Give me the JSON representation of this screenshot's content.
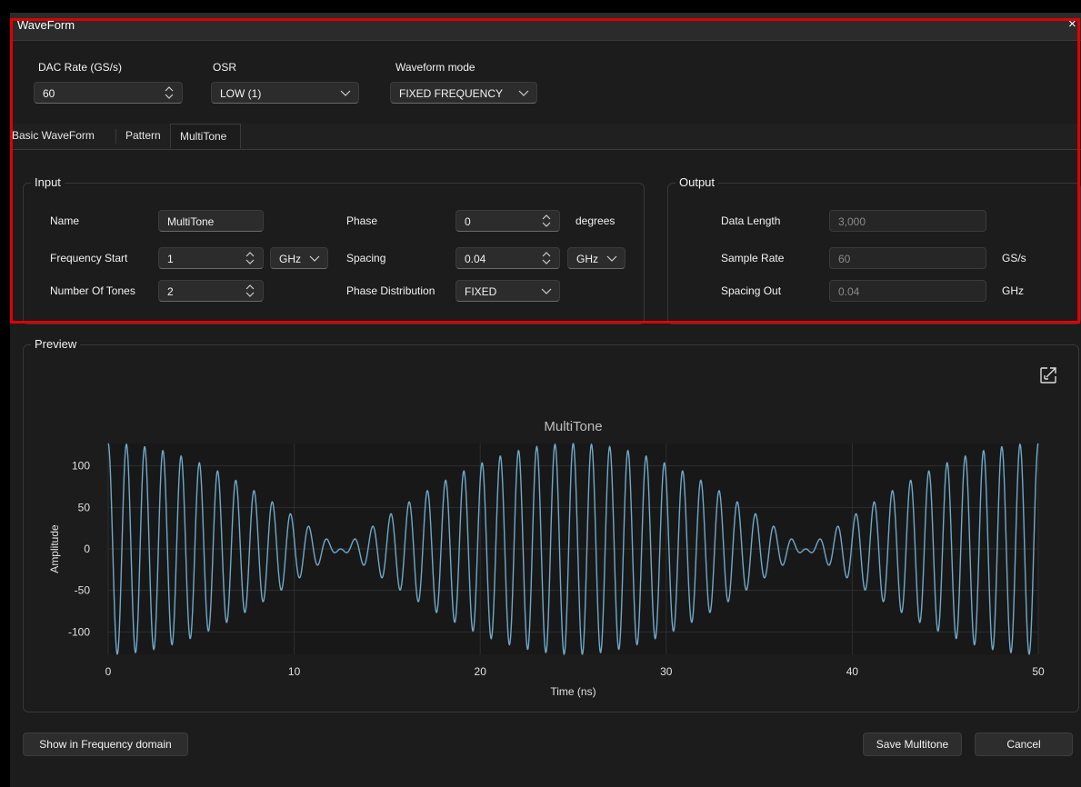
{
  "window": {
    "title": "WaveForm",
    "close": "×"
  },
  "top": {
    "dac_rate_label": "DAC Rate (GS/s)",
    "dac_rate_value": "60",
    "osr_label": "OSR",
    "osr_value": "LOW (1)",
    "waveform_mode_label": "Waveform mode",
    "waveform_mode_value": "FIXED FREQUENCY"
  },
  "tabs": [
    {
      "label": "Basic WaveForm"
    },
    {
      "label": "Pattern"
    },
    {
      "label": "MultiTone",
      "active": true
    }
  ],
  "input": {
    "title": "Input",
    "name_label": "Name",
    "name_value": "MultiTone",
    "freq_start_label": "Frequency Start",
    "freq_start_value": "1",
    "freq_unit": "GHz",
    "num_tones_label": "Number Of Tones",
    "num_tones_value": "2",
    "phase_label": "Phase",
    "phase_value": "0",
    "phase_unit": "degrees",
    "spacing_label": "Spacing",
    "spacing_value": "0.04",
    "spacing_unit": "GHz",
    "phase_dist_label": "Phase Distribution",
    "phase_dist_value": "FIXED"
  },
  "output": {
    "title": "Output",
    "data_length_label": "Data Length",
    "data_length_value": "3,000",
    "sample_rate_label": "Sample Rate",
    "sample_rate_value": "60",
    "sample_rate_unit": "GS/s",
    "spacing_out_label": "Spacing Out",
    "spacing_out_value": "0.04",
    "spacing_out_unit": "GHz"
  },
  "preview": {
    "title": "Preview",
    "expand_icon": "expand-icon"
  },
  "chart_data": {
    "type": "line",
    "title": "MultiTone",
    "xlabel": "Time (ns)",
    "ylabel": "Amplitude",
    "xlim": [
      0,
      50
    ],
    "ylim": [
      -127,
      127
    ],
    "xticks": [
      0,
      10,
      20,
      30,
      40,
      50
    ],
    "yticks": [
      100,
      50,
      0,
      -50,
      -100
    ],
    "grid": true,
    "series": [
      {
        "color": "#6fa8c8",
        "function": "two-tone sum: 63.5*cos(2π·1.00·t) + 63.5*cos(2π·1.04·t), t in ns",
        "tones_ghz": [
          1.0,
          1.04
        ],
        "amplitude_peak": 127,
        "sample_rate_gsps": 60,
        "points": 3000
      }
    ]
  },
  "footer": {
    "freq_domain_label": "Show in Frequency domain",
    "save_label": "Save Multitone",
    "cancel_label": "Cancel"
  }
}
